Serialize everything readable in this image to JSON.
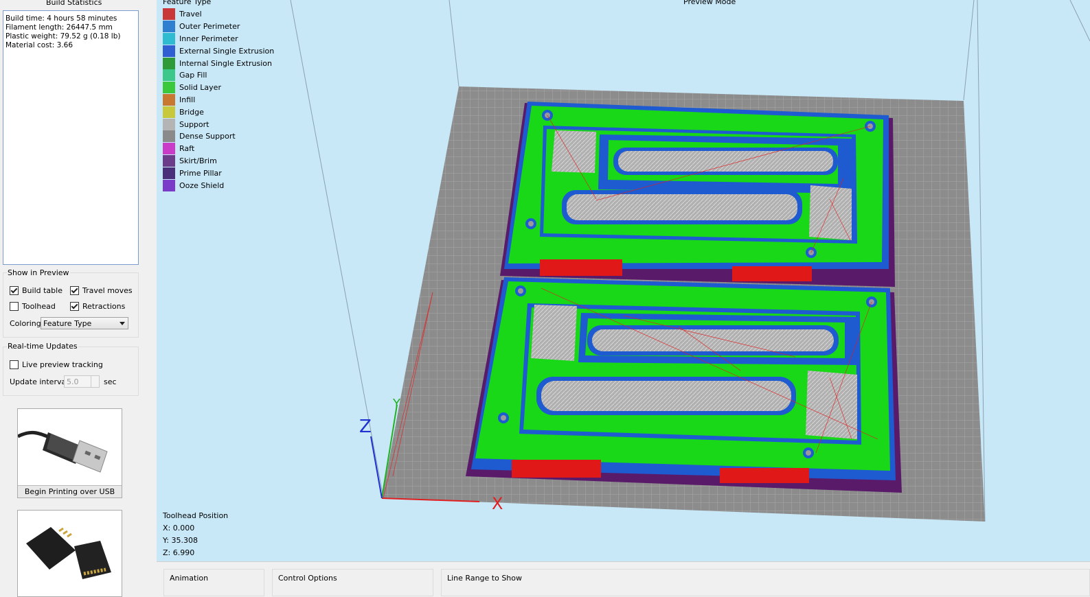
{
  "build_stats": {
    "title": "Build Statistics",
    "lines": [
      "Build time: 4 hours 58 minutes",
      "Filament length: 26447.5 mm",
      "Plastic weight: 79.52 g (0.18 lb)",
      "Material cost: 3.66"
    ]
  },
  "show_in_preview": {
    "title": "Show in Preview",
    "build_table": {
      "label": "Build table",
      "checked": true
    },
    "travel_moves": {
      "label": "Travel moves",
      "checked": true
    },
    "toolhead": {
      "label": "Toolhead",
      "checked": false
    },
    "retractions": {
      "label": "Retractions",
      "checked": true
    },
    "coloring_label": "Coloring",
    "coloring_value": "Feature Type"
  },
  "realtime": {
    "title": "Real-time Updates",
    "live_tracking": {
      "label": "Live preview tracking",
      "checked": false
    },
    "interval_label": "Update interval",
    "interval_value": "5.0",
    "interval_unit": "sec"
  },
  "cards": {
    "usb_label": "Begin Printing over USB"
  },
  "viewport": {
    "mode_title": "Preview Mode",
    "legend_title": "Feature Type",
    "legend": [
      {
        "label": "Travel",
        "color": "#c83838"
      },
      {
        "label": "Outer Perimeter",
        "color": "#2f7fd0"
      },
      {
        "label": "Inner Perimeter",
        "color": "#2fbcd0"
      },
      {
        "label": "External Single Extrusion",
        "color": "#2f5fd0"
      },
      {
        "label": "Internal Single Extrusion",
        "color": "#2f9a3a"
      },
      {
        "label": "Gap Fill",
        "color": "#3cc88a"
      },
      {
        "label": "Solid Layer",
        "color": "#3cc83c"
      },
      {
        "label": "Infill",
        "color": "#c8782f"
      },
      {
        "label": "Bridge",
        "color": "#c8c83c"
      },
      {
        "label": "Support",
        "color": "#b4b4b4"
      },
      {
        "label": "Dense Support",
        "color": "#8a8a8a"
      },
      {
        "label": "Raft",
        "color": "#c83cc8"
      },
      {
        "label": "Skirt/Brim",
        "color": "#6a3c8a"
      },
      {
        "label": "Prime Pillar",
        "color": "#4a2f7a"
      },
      {
        "label": "Ooze Shield",
        "color": "#7a3cc8"
      }
    ],
    "toolhead_title": "Toolhead Position",
    "x": "X: 0.000",
    "y": "Y: 35.308",
    "z": "Z: 6.990",
    "axis_x": "X",
    "axis_y": "Y",
    "axis_z": "Z"
  },
  "bottom_tabs": {
    "animation": "Animation",
    "control": "Control Options",
    "line_range": "Line Range to Show"
  }
}
